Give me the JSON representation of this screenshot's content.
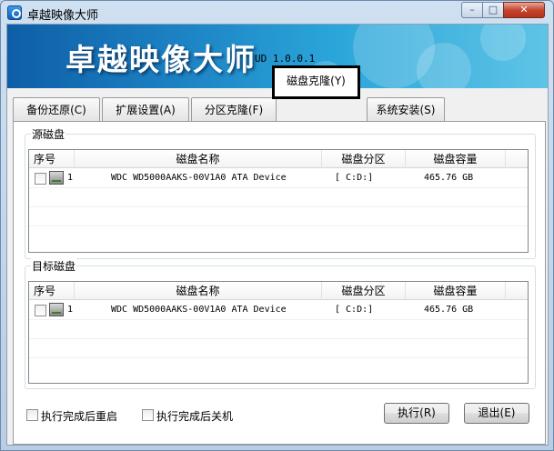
{
  "window": {
    "title": "卓越映像大师",
    "min_label": "–",
    "max_label": "□",
    "close_label": "✕"
  },
  "banner": {
    "title": "卓越映像大师",
    "version": "UD 1.0.0.1"
  },
  "tabs": [
    {
      "label": "备份还原(C)"
    },
    {
      "label": "扩展设置(A)"
    },
    {
      "label": "分区克隆(F)"
    },
    {
      "label": "磁盘克隆(Y)",
      "active": true
    },
    {
      "label": "系统安装(S)"
    }
  ],
  "columns": {
    "index": "序号",
    "name": "磁盘名称",
    "partition": "磁盘分区",
    "capacity": "磁盘容量"
  },
  "source": {
    "label": "源磁盘",
    "rows": [
      {
        "index": "1",
        "name": "WDC WD5000AAKS-00V1A0 ATA Device",
        "partition": "[ C:D:]",
        "capacity": "465.76 GB",
        "checked": false
      }
    ]
  },
  "target": {
    "label": "目标磁盘",
    "rows": [
      {
        "index": "1",
        "name": "WDC WD5000AAKS-00V1A0 ATA Device",
        "partition": "[ C:D:]",
        "capacity": "465.76 GB",
        "checked": false
      }
    ]
  },
  "options": {
    "reboot_label": "执行完成后重启",
    "shutdown_label": "执行完成后关机"
  },
  "buttons": {
    "execute": "执行(R)",
    "exit": "退出(E)"
  }
}
